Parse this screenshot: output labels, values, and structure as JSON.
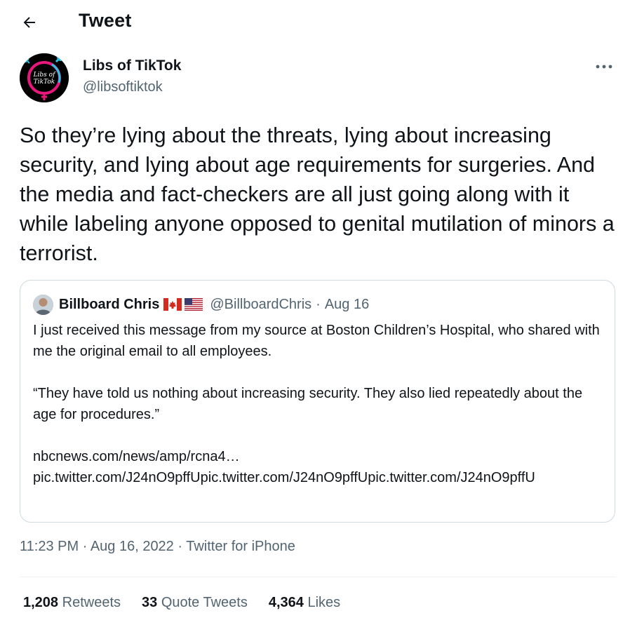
{
  "header": {
    "title": "Tweet",
    "back_icon": "arrow-left-icon"
  },
  "author": {
    "name": "Libs of TikTok",
    "handle": "@libsoftiktok",
    "avatar_text_line1": "Libs of",
    "avatar_text_line2": "TikTok",
    "more_icon": "more-horizontal-icon"
  },
  "tweet": {
    "text": "So they’re lying about the threats, lying about increasing security, and lying about age requirements for surgeries. And the media and fact-checkers are all just going along with it while labeling anyone opposed to genital mutilation of minors a terrorist."
  },
  "quote": {
    "name": "Billboard Chris",
    "flags": [
      "canada-flag-icon",
      "us-flag-icon"
    ],
    "handle": "@BillboardChris",
    "separator": "·",
    "date": "Aug 16",
    "paragraph1": "I just received this message from my source at Boston Children’s Hospital, who shared with me the original email to all employees.",
    "paragraph2": "“They have told us nothing about increasing security. They also lied repeatedly about the age for procedures.”",
    "link1": "nbcnews.com/news/amp/rcna4…",
    "link2": "pic.twitter.com/J24nO9pffUpic.twitter.com/J24nO9pffUpic.twitter.com/J24nO9pffU"
  },
  "meta": {
    "time": "11:23 PM",
    "separator": "·",
    "date": "Aug 16, 2022",
    "source": "Twitter for iPhone"
  },
  "stats": {
    "retweets_count": "1,208",
    "retweets_label": "Retweets",
    "quotes_count": "33",
    "quotes_label": "Quote Tweets",
    "likes_count": "4,364",
    "likes_label": "Likes"
  },
  "colors": {
    "text": "#0f1419",
    "secondary": "#536471",
    "border": "#cfd9de",
    "divider": "#eff3f4",
    "avatar_ring_pink": "#e8177d",
    "avatar_ring_cyan": "#29c5e6"
  }
}
